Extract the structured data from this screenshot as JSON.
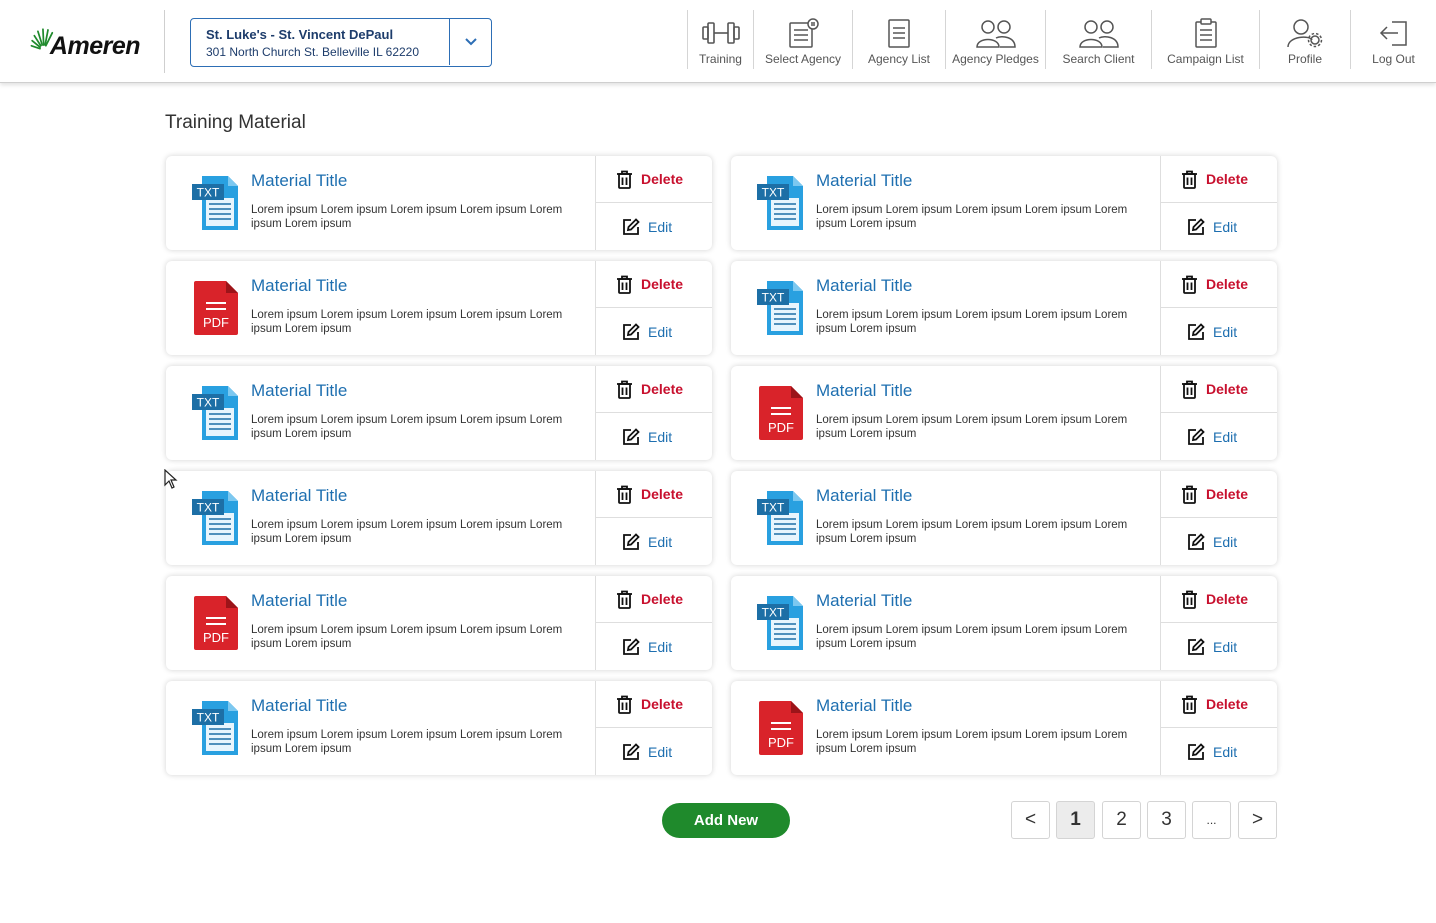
{
  "header": {
    "logo_text": "Ameren",
    "agency": {
      "name": "St. Luke's - St. Vincent DePaul",
      "address": "301 North Church St. Belleville IL 62220"
    },
    "nav": [
      {
        "label": "Training",
        "icon": "dumbbell-icon"
      },
      {
        "label": "Select Agency",
        "icon": "document-select-icon"
      },
      {
        "label": "Agency List",
        "icon": "list-document-icon"
      },
      {
        "label": "Agency Pledges",
        "icon": "people-icon"
      },
      {
        "label": "Search Client",
        "icon": "people-search-icon"
      },
      {
        "label": "Campaign List",
        "icon": "clipboard-icon"
      },
      {
        "label": "Profile",
        "icon": "user-gear-icon"
      },
      {
        "label": "Log Out",
        "icon": "logout-icon"
      }
    ]
  },
  "main": {
    "title": "Training Material",
    "delete_label": "Delete",
    "edit_label": "Edit",
    "cards": [
      {
        "type": "TXT",
        "title": "Material Title",
        "desc": "Lorem ipsum Lorem ipsum Lorem ipsum Lorem ipsum Lorem ipsum Lorem ipsum"
      },
      {
        "type": "TXT",
        "title": "Material Title",
        "desc": "Lorem ipsum Lorem ipsum Lorem ipsum Lorem ipsum Lorem ipsum Lorem ipsum"
      },
      {
        "type": "PDF",
        "title": "Material Title",
        "desc": "Lorem ipsum Lorem ipsum Lorem ipsum Lorem ipsum Lorem ipsum Lorem ipsum"
      },
      {
        "type": "TXT",
        "title": "Material Title",
        "desc": "Lorem ipsum Lorem ipsum Lorem ipsum Lorem ipsum Lorem ipsum Lorem ipsum"
      },
      {
        "type": "TXT",
        "title": "Material Title",
        "desc": "Lorem ipsum Lorem ipsum Lorem ipsum Lorem ipsum Lorem ipsum Lorem ipsum"
      },
      {
        "type": "PDF",
        "title": "Material Title",
        "desc": "Lorem ipsum Lorem ipsum Lorem ipsum Lorem ipsum Lorem ipsum Lorem ipsum"
      },
      {
        "type": "TXT",
        "title": "Material Title",
        "desc": "Lorem ipsum Lorem ipsum Lorem ipsum Lorem ipsum Lorem ipsum Lorem ipsum"
      },
      {
        "type": "TXT",
        "title": "Material Title",
        "desc": "Lorem ipsum Lorem ipsum Lorem ipsum Lorem ipsum Lorem ipsum Lorem ipsum"
      },
      {
        "type": "PDF",
        "title": "Material Title",
        "desc": "Lorem ipsum Lorem ipsum Lorem ipsum Lorem ipsum Lorem ipsum Lorem ipsum"
      },
      {
        "type": "TXT",
        "title": "Material Title",
        "desc": "Lorem ipsum Lorem ipsum Lorem ipsum Lorem ipsum Lorem ipsum Lorem ipsum"
      },
      {
        "type": "TXT",
        "title": "Material Title",
        "desc": "Lorem ipsum Lorem ipsum Lorem ipsum Lorem ipsum Lorem ipsum Lorem ipsum"
      },
      {
        "type": "PDF",
        "title": "Material Title",
        "desc": "Lorem ipsum Lorem ipsum Lorem ipsum Lorem ipsum Lorem ipsum Lorem ipsum"
      }
    ],
    "add_new_label": "Add New",
    "pagination": {
      "prev": "<",
      "pages": [
        "1",
        "2",
        "3"
      ],
      "ellipsis": "...",
      "next": ">",
      "current": "1"
    }
  },
  "colors": {
    "accent_blue": "#1e6fb0",
    "delete_red": "#c8102e",
    "add_green": "#1f8a2c",
    "txt_icon": "#29a0e0",
    "pdf_icon": "#d9232a"
  }
}
